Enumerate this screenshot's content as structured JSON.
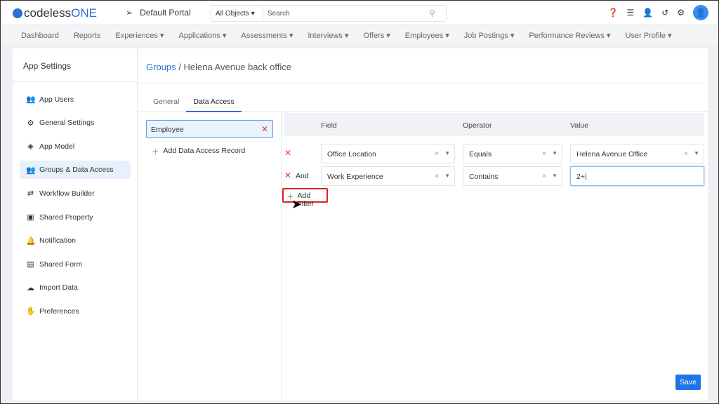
{
  "header": {
    "logo": "codeless",
    "logo_accent": "ONE",
    "portal": "Default Portal",
    "search_scope": "All Objects",
    "search_placeholder": "Search",
    "icons": [
      "help-icon",
      "database-icon",
      "add-user-icon",
      "history-icon",
      "gear-icon",
      "user-avatar-icon"
    ]
  },
  "nav": [
    "Dashboard",
    "Reports",
    "Experiences ▾",
    "Applications ▾",
    "Assessments ▾",
    "Interviews ▾",
    "Offers ▾",
    "Employees ▾",
    "Job Postings ▾",
    "Performance Reviews ▾",
    "User Profile ▾"
  ],
  "sidebar": {
    "title": "App Settings",
    "items": [
      {
        "label": "App Users",
        "icon": "users-icon"
      },
      {
        "label": "General Settings",
        "icon": "gear-icon"
      },
      {
        "label": "App Model",
        "icon": "cube-icon"
      },
      {
        "label": "Groups & Data Access",
        "icon": "group-icon",
        "active": true
      },
      {
        "label": "Workflow Builder",
        "icon": "arrows-icon"
      },
      {
        "label": "Shared Property",
        "icon": "archive-icon"
      },
      {
        "label": "Notification",
        "icon": "bell-icon"
      },
      {
        "label": "Shared Form",
        "icon": "form-icon"
      },
      {
        "label": "Import Data",
        "icon": "cloud-upload-icon"
      },
      {
        "label": "Preferences",
        "icon": "hand-icon"
      }
    ]
  },
  "breadcrumb": {
    "link": "Groups",
    "sep": " / ",
    "current": "Helena Avenue back office"
  },
  "tabs": [
    {
      "label": "General"
    },
    {
      "label": "Data Access",
      "active": true
    }
  ],
  "records": {
    "selected": "Employee",
    "add_label": "Add Data Access Record"
  },
  "filters": {
    "headers": {
      "field": "Field",
      "operator": "Operator",
      "value": "Value"
    },
    "rows": [
      {
        "conj": "",
        "field": "Office Location",
        "operator": "Equals",
        "value": "Helena Avenue Office"
      },
      {
        "conj": "And",
        "field": "Work Experience",
        "operator": "Contains",
        "value": "2+"
      }
    ],
    "add_label": "Add Filter"
  },
  "save_label": "Save"
}
